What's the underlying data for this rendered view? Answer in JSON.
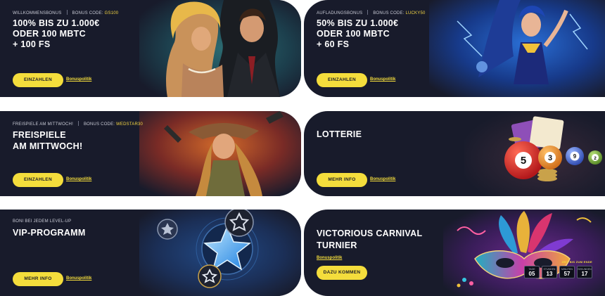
{
  "banners": [
    {
      "tag": "WILLKOMMENSBONUS",
      "code_prefix": "BONUS CODE:",
      "code": "GS100",
      "title_lines": [
        "100% BIS ZU 1.000€",
        "ODER 100 MBTC",
        "+ 100 FS"
      ],
      "button": "EINZAHLEN",
      "policy": "Bonuspolitik"
    },
    {
      "tag": "AUFLADUNGSBONUS",
      "code_prefix": "BONUS CODE:",
      "code": "LUCKY50",
      "title_lines": [
        "50% BIS ZU 1.000€",
        "ODER 100 MBTC",
        "+ 60 FS"
      ],
      "button": "EINZAHLEN",
      "policy": "Bonuspolitik"
    },
    {
      "tag": "FREISPIELE AM MITTWOCH!",
      "code_prefix": "BONUS CODE:",
      "code": "WEDSTAR30",
      "title_lines": [
        "FREISPIELE",
        "AM MITTWOCH!"
      ],
      "button": "EINZAHLEN",
      "policy": "Bonuspolitik"
    },
    {
      "title_lines": [
        "LOTTERIE"
      ],
      "button": "MEHR INFO",
      "policy": "Bonuspolitik",
      "balls": [
        "5",
        "3",
        "9",
        "2"
      ]
    },
    {
      "tag": "BONI BEI JEDEM LEVEL-UP",
      "title_lines": [
        "VIP-PROGRAMM"
      ],
      "button": "MEHR INFO",
      "policy": "Bonuspolitik"
    },
    {
      "title_lines": [
        "VICTORIOUS CARNIVAL",
        "TURNIER"
      ],
      "button": "DAZU KOMMEN",
      "policy": "Bonuspolitik",
      "timer_label": "ZEIT BIS ZUM ENDE",
      "timer": [
        {
          "label": "TAGE",
          "value": "05"
        },
        {
          "label": "STUNDEN",
          "value": "13"
        },
        {
          "label": "MINUTEN",
          "value": "57"
        },
        {
          "label": "SEKUNDEN",
          "value": "17"
        }
      ]
    }
  ],
  "colors": {
    "card_bg": "#181b2b",
    "accent_yellow": "#f4dd3c",
    "code_yellow": "#f6d743",
    "text_white": "#ffffff"
  }
}
